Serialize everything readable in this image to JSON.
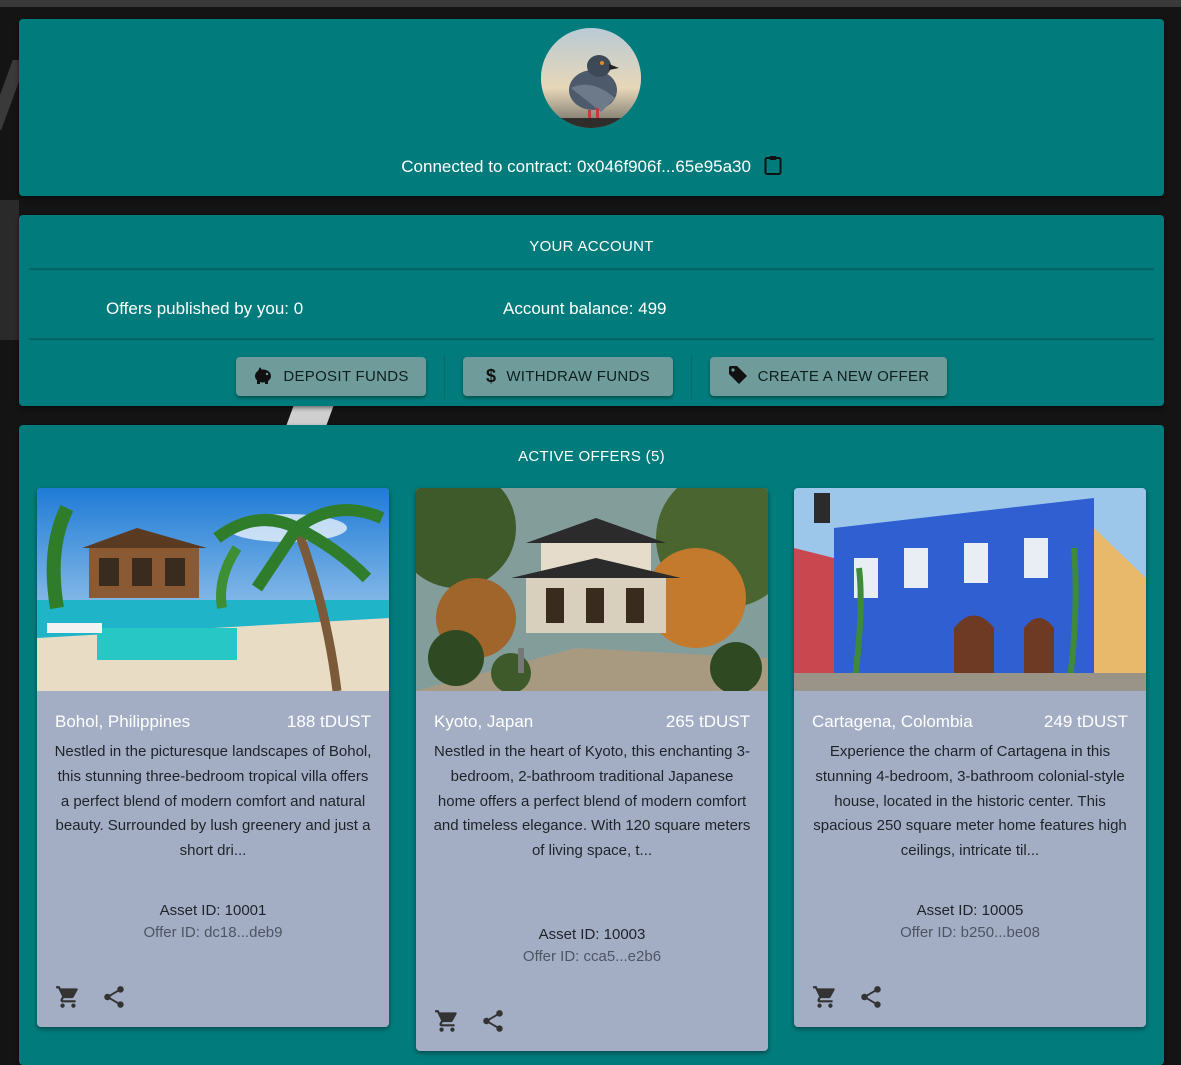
{
  "header": {
    "contract_label": "Connected to contract: 0x046f906f...65e95a30"
  },
  "account": {
    "title": "YOUR ACCOUNT",
    "offers_published": "Offers published by you: 0",
    "balance": "Account balance: 499",
    "buttons": {
      "deposit": "DEPOSIT FUNDS",
      "withdraw": "WITHDRAW FUNDS",
      "create": "CREATE A NEW OFFER"
    }
  },
  "offers": {
    "title": "ACTIVE OFFERS (5)",
    "items": [
      {
        "location": "Bohol, Philippines",
        "price": "188 tDUST",
        "description": "Nestled in the picturesque landscapes of Bohol, this stunning three-bedroom tropical villa offers a perfect blend of modern comfort and natural beauty. Surrounded by lush greenery and just a short dri...",
        "asset_id": "Asset ID: 10001",
        "offer_id": "Offer ID: dc18...deb9"
      },
      {
        "location": "Kyoto, Japan",
        "price": "265 tDUST",
        "description": "Nestled in the heart of Kyoto, this enchanting 3-bedroom, 2-bathroom traditional Japanese home offers a perfect blend of modern comfort and timeless elegance. With 120 square meters of living space, t...",
        "asset_id": "Asset ID: 10003",
        "offer_id": "Offer ID: cca5...e2b6"
      },
      {
        "location": "Cartagena, Colombia",
        "price": "249 tDUST",
        "description": "Experience the charm of Cartagena in this stunning 4-bedroom, 3-bathroom colonial-style house, located in the historic center. This spacious 250 square meter home features high ceilings, intricate til...",
        "asset_id": "Asset ID: 10005",
        "offer_id": "Offer ID: b250...be08"
      }
    ]
  },
  "colors": {
    "panel": "#017b7b",
    "button": "#6f9c9a",
    "card": "#a3aec5",
    "background": "#141414"
  },
  "icons": {
    "copy": "clipboard-icon",
    "deposit": "piggy-bank-icon",
    "withdraw": "dollar-icon",
    "create": "tag-icon",
    "cart": "shopping-cart-icon",
    "share": "share-icon"
  }
}
